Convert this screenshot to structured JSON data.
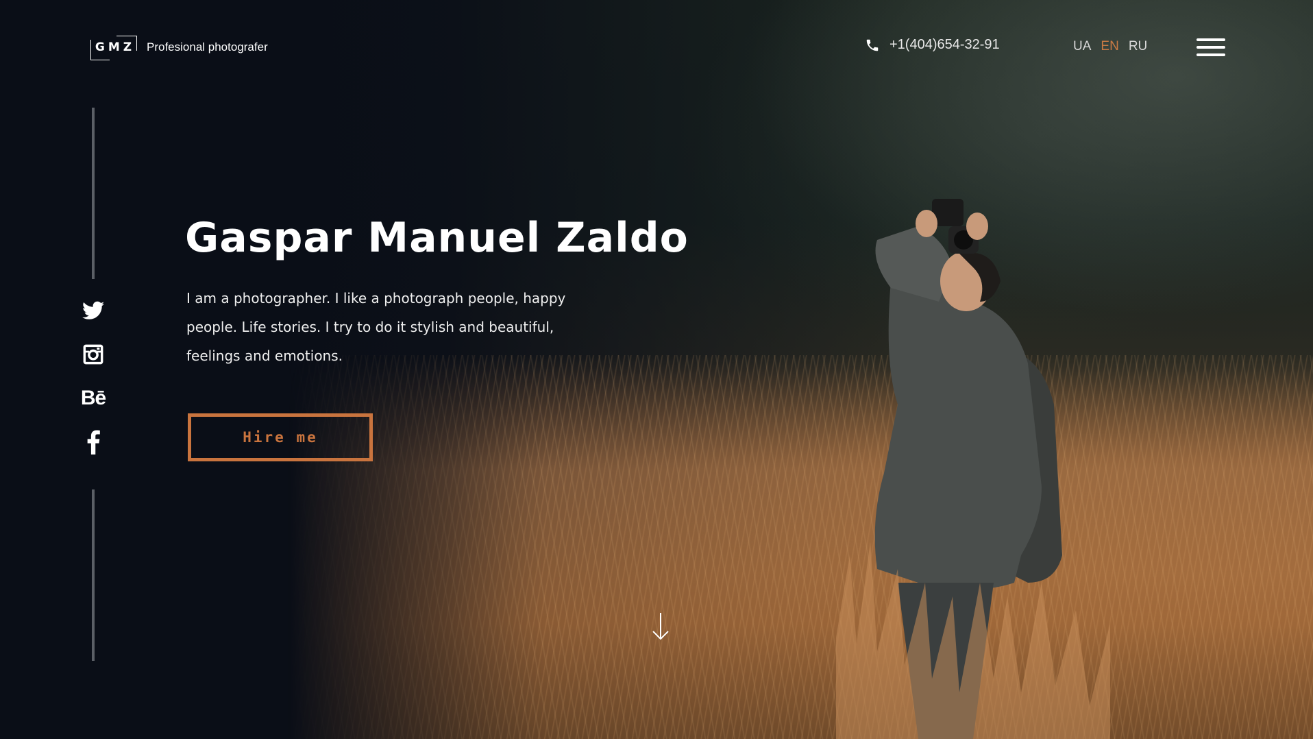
{
  "header": {
    "logo_mark": "GMZ",
    "tagline": "Profesional photografer",
    "phone": "+1(404)654-32-91",
    "languages": [
      {
        "code": "UA",
        "active": false
      },
      {
        "code": "EN",
        "active": true
      },
      {
        "code": "RU",
        "active": false
      }
    ],
    "menu_icon": "hamburger-menu-icon"
  },
  "social": [
    {
      "name": "twitter",
      "icon": "twitter-icon"
    },
    {
      "name": "instagram",
      "icon": "instagram-icon"
    },
    {
      "name": "behance",
      "label": "Bē",
      "icon": "behance-icon"
    },
    {
      "name": "facebook",
      "icon": "facebook-icon"
    }
  ],
  "hero": {
    "title": "Gaspar Manuel Zaldo",
    "description": "I am a photographer. I like a photograph people, happy people. Life stories. I try to do it stylish and beautiful, feelings and emotions.",
    "cta_label": "Hire me",
    "scroll_icon": "arrow-down-icon"
  },
  "colors": {
    "accent": "#c9743e",
    "background": "#0b0f18",
    "divider": "#5b5f66"
  }
}
